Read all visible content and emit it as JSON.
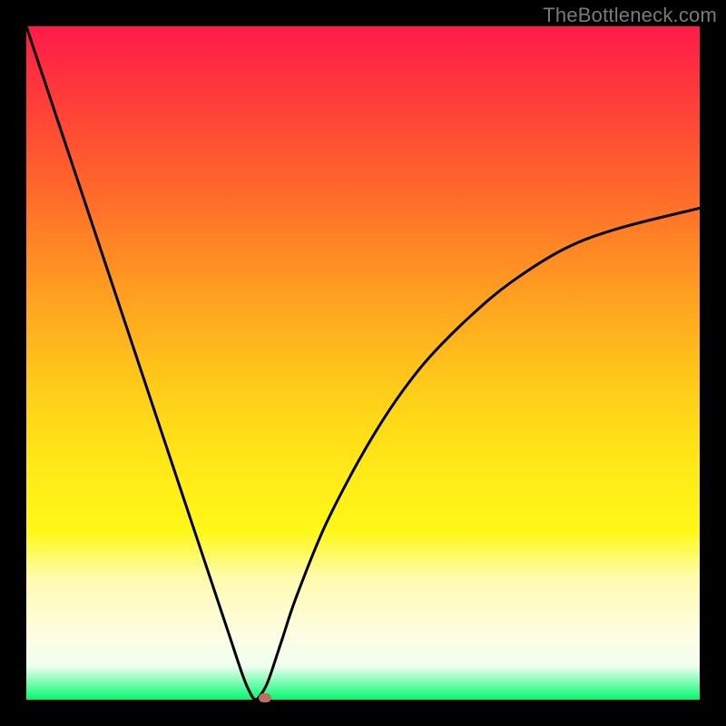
{
  "watermark": "TheBottleneck.com",
  "plot": {
    "inner_left": 29,
    "inner_top": 29,
    "inner_width": 742,
    "inner_height": 742
  },
  "chart_data": {
    "type": "line",
    "title": "",
    "xlabel": "",
    "ylabel": "",
    "xlim": [
      0,
      100
    ],
    "ylim": [
      0,
      100
    ],
    "annotations": [
      "TheBottleneck.com"
    ],
    "minimum_x": 34,
    "marker": {
      "x": 35.5,
      "y": 0,
      "color": "#bb715f"
    },
    "x": [
      0,
      4,
      8,
      12,
      16,
      20,
      24,
      28,
      30,
      32,
      33,
      34,
      35,
      36,
      38,
      40,
      44,
      48,
      52,
      56,
      60,
      66,
      72,
      80,
      88,
      100
    ],
    "values": [
      100,
      88,
      76,
      64,
      52,
      40,
      28,
      16,
      10,
      4,
      1.5,
      0,
      1,
      3,
      9,
      15,
      25,
      33,
      40,
      46,
      51,
      57,
      62,
      67,
      70,
      73
    ]
  }
}
